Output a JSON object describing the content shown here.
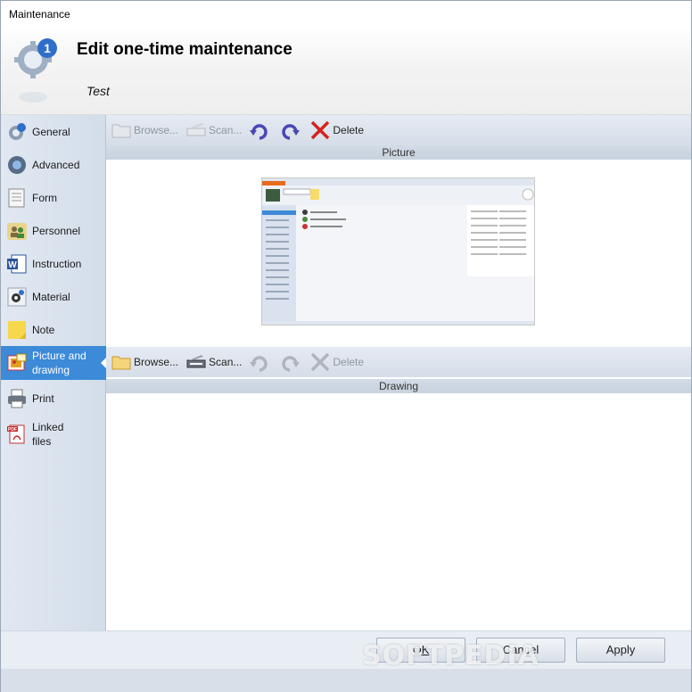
{
  "window": {
    "title": "Maintenance"
  },
  "header": {
    "heading": "Edit one-time maintenance",
    "subheading": "Test"
  },
  "sidebar": {
    "items": [
      {
        "label": "General"
      },
      {
        "label": "Advanced"
      },
      {
        "label": "Form"
      },
      {
        "label": "Personnel"
      },
      {
        "label": "Instruction"
      },
      {
        "label": "Material"
      },
      {
        "label": "Note"
      },
      {
        "label": "Picture and drawing",
        "active": true
      },
      {
        "label": "Print"
      },
      {
        "label": "Linked files"
      }
    ]
  },
  "picture_section": {
    "toolbar": {
      "browse": "Browse...",
      "scan": "Scan...",
      "delete": "Delete"
    },
    "label": "Picture"
  },
  "drawing_section": {
    "toolbar": {
      "browse": "Browse...",
      "scan": "Scan...",
      "delete": "Delete"
    },
    "label": "Drawing"
  },
  "footer": {
    "ok": "OK",
    "cancel": "Cancel",
    "apply": "Apply",
    "watermark": "SOFTPEDIA"
  },
  "colors": {
    "active_nav": "#3c8ad8",
    "toolbar": "#d5dde8",
    "sidebar": "#d3dde9"
  }
}
